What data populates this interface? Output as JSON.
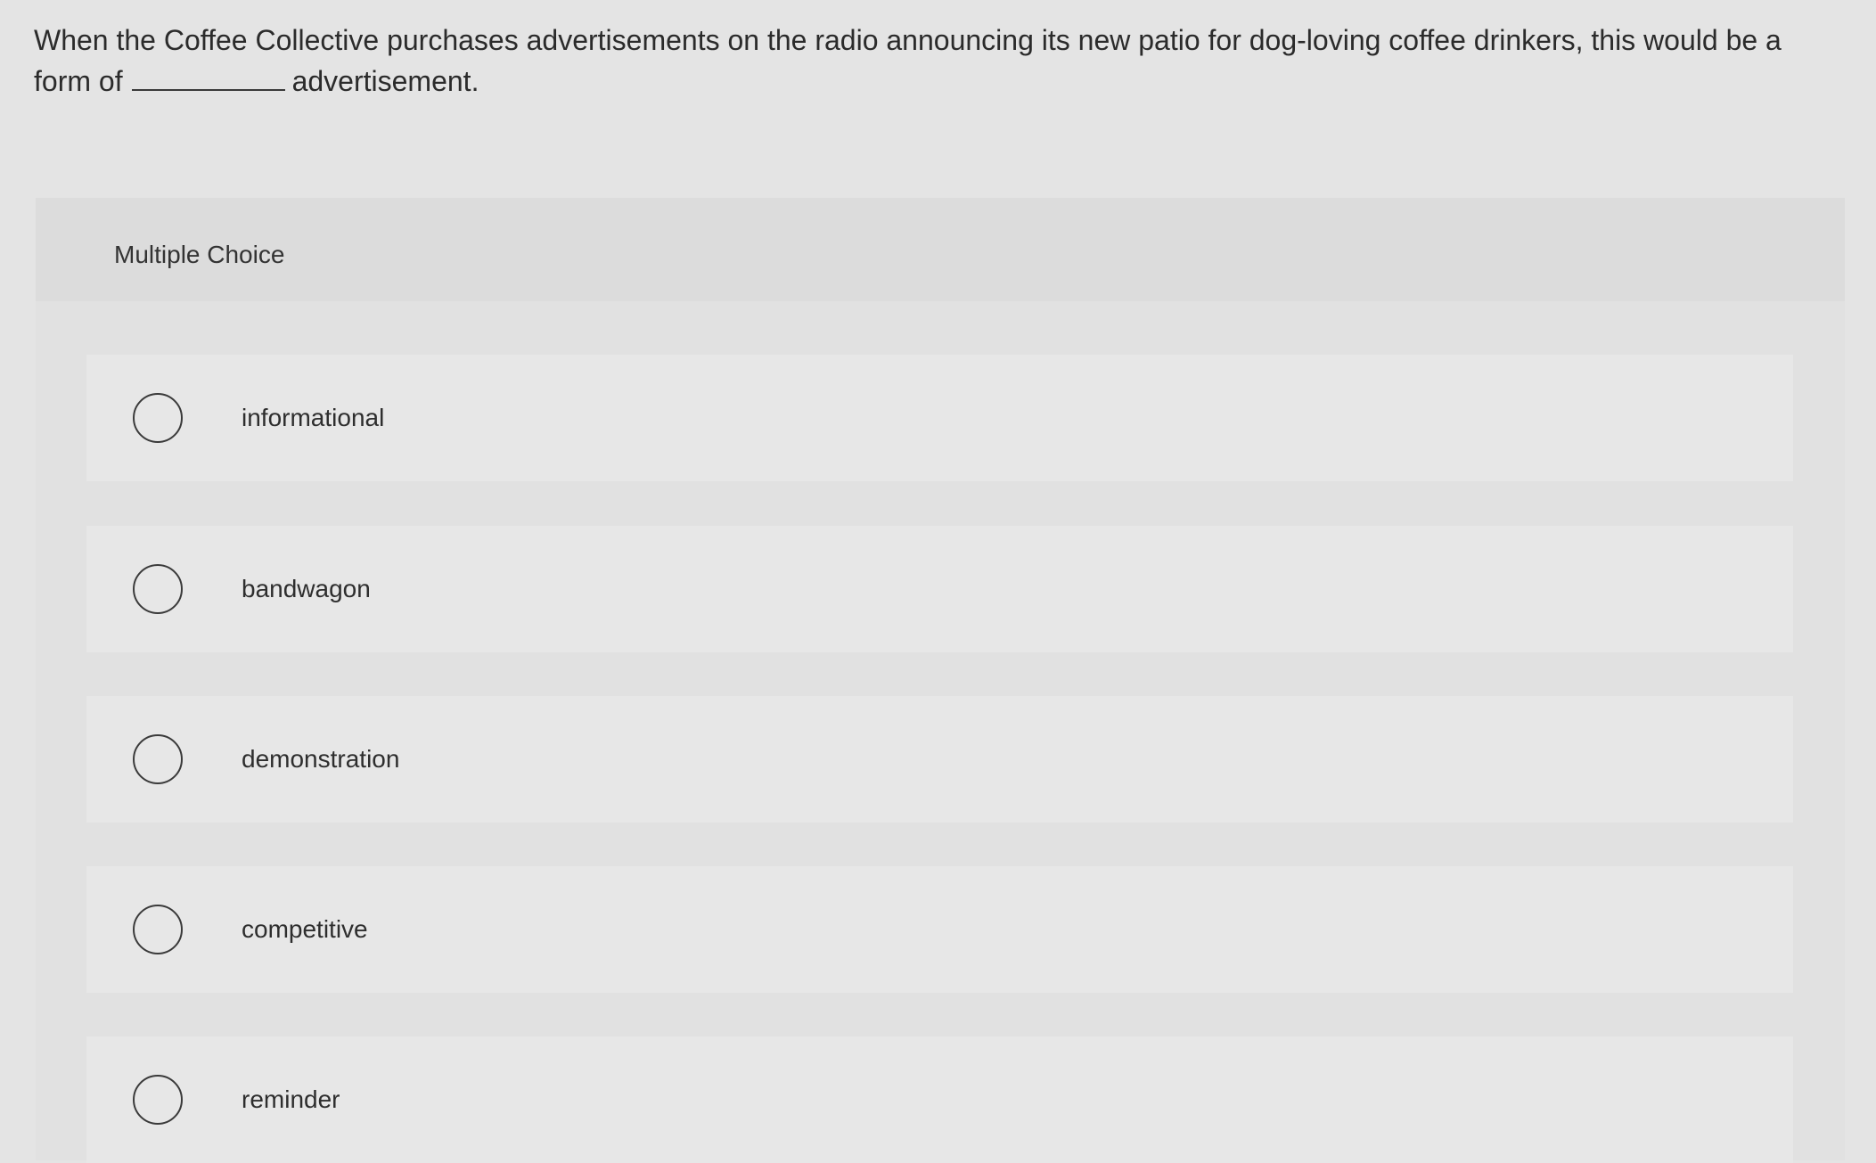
{
  "question": {
    "part1": "When the Coffee Collective purchases advertisements on the radio announcing its new patio for dog-loving coffee drinkers, this would be a form of",
    "part2": "advertisement."
  },
  "multiple_choice": {
    "label": "Multiple Choice",
    "options": [
      {
        "label": "informational"
      },
      {
        "label": "bandwagon"
      },
      {
        "label": "demonstration"
      },
      {
        "label": "competitive"
      },
      {
        "label": "reminder"
      }
    ]
  }
}
